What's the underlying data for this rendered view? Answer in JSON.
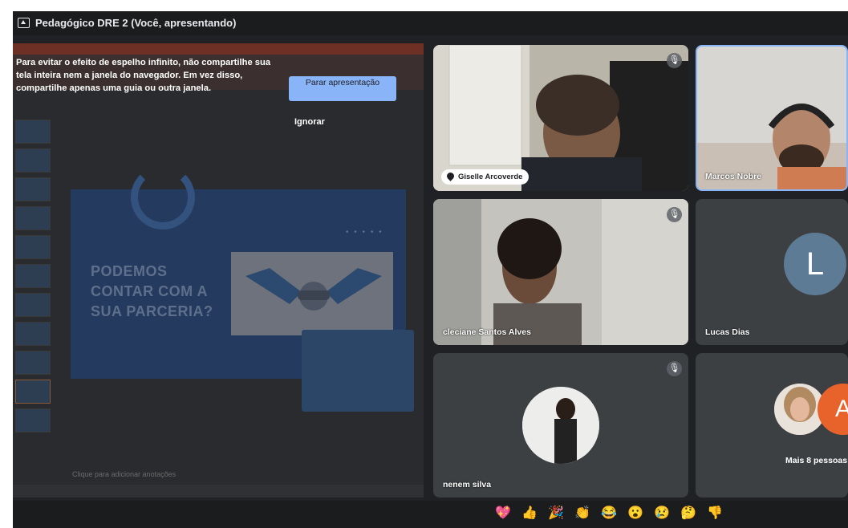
{
  "window": {
    "title": "Pedagógico DRE 2 (Você, apresentando)"
  },
  "presentation": {
    "warning_text": "Para evitar o efeito de espelho infinito, não compartilhe sua tela inteira nem a janela do navegador. Em vez disso, compartilhe apenas uma guia ou outra janela.",
    "stop_button": "Parar apresentação",
    "ignore_button": "Ignorar",
    "slide_headline": [
      "PODEMOS",
      "CONTAR COM A",
      "SUA PARCERIA?"
    ],
    "slide_dots": "• • • • •",
    "notes_placeholder": "Clique para adicionar anotações"
  },
  "participants": [
    {
      "name": "Giselle Arcoverde",
      "pinned": true,
      "muted": true
    },
    {
      "name": "Marcos Nobre",
      "highlighted": true
    },
    {
      "name": "cleciane Santos Alves",
      "muted": true
    },
    {
      "name": "Lucas Dias",
      "avatar_letter": "L"
    },
    {
      "name": "nenem silva",
      "muted": true
    },
    {
      "name": "Mais 8 pessoas",
      "avatar_letter": "A"
    }
  ],
  "reactions": [
    "💖",
    "👍",
    "🎉",
    "👏",
    "😂",
    "😮",
    "😢",
    "🤔",
    "👎"
  ],
  "colors": {
    "accent": "#8ab4f8",
    "tile_bg": "#3c4043",
    "frame_bg": "#202124",
    "avatar_L": "#5d7b94",
    "avatar_A": "#e8632b"
  }
}
